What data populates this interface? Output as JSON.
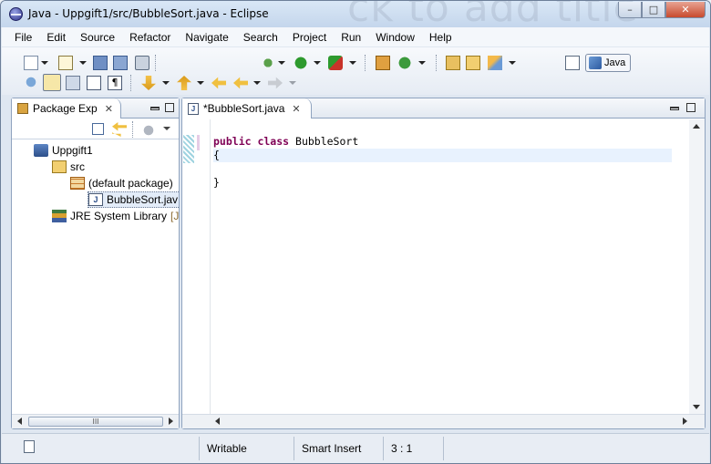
{
  "window": {
    "title": "Java - Uppgift1/src/BubbleSort.java - Eclipse",
    "background_text": "ck to add title",
    "minimize_label": "–",
    "maximize_label": "□",
    "close_label": "✕"
  },
  "menubar": {
    "items": [
      "File",
      "Edit",
      "Source",
      "Refactor",
      "Navigate",
      "Search",
      "Project",
      "Run",
      "Window",
      "Help"
    ]
  },
  "toolbar": {
    "perspective_label": "Java"
  },
  "package_explorer": {
    "tab_label": "Package Exp",
    "tree": [
      {
        "label": "Uppgift1",
        "icon": "project-icon"
      },
      {
        "label": "src",
        "icon": "source-folder-icon"
      },
      {
        "label": "(default package)",
        "icon": "package-icon"
      },
      {
        "label": "BubbleSort.jav",
        "icon": "java-file-icon"
      },
      {
        "label": "JRE System Library",
        "suffix": "[Ja",
        "icon": "library-icon"
      }
    ],
    "scroll_grip": "III"
  },
  "editor": {
    "tab_label": "*BubbleSort.java",
    "lines": [
      {
        "keywords": "public class",
        "text": " BubbleSort"
      },
      {
        "keywords": "",
        "text": "{"
      },
      {
        "keywords": "",
        "text": ""
      },
      {
        "keywords": "",
        "text": "}"
      }
    ]
  },
  "statusbar": {
    "writable": "Writable",
    "insert_mode": "Smart Insert",
    "position": "3 : 1"
  },
  "colors": {
    "keyword": "#7f0055",
    "current_line": "#e8f2fe",
    "close_button": "#c84a2d"
  }
}
